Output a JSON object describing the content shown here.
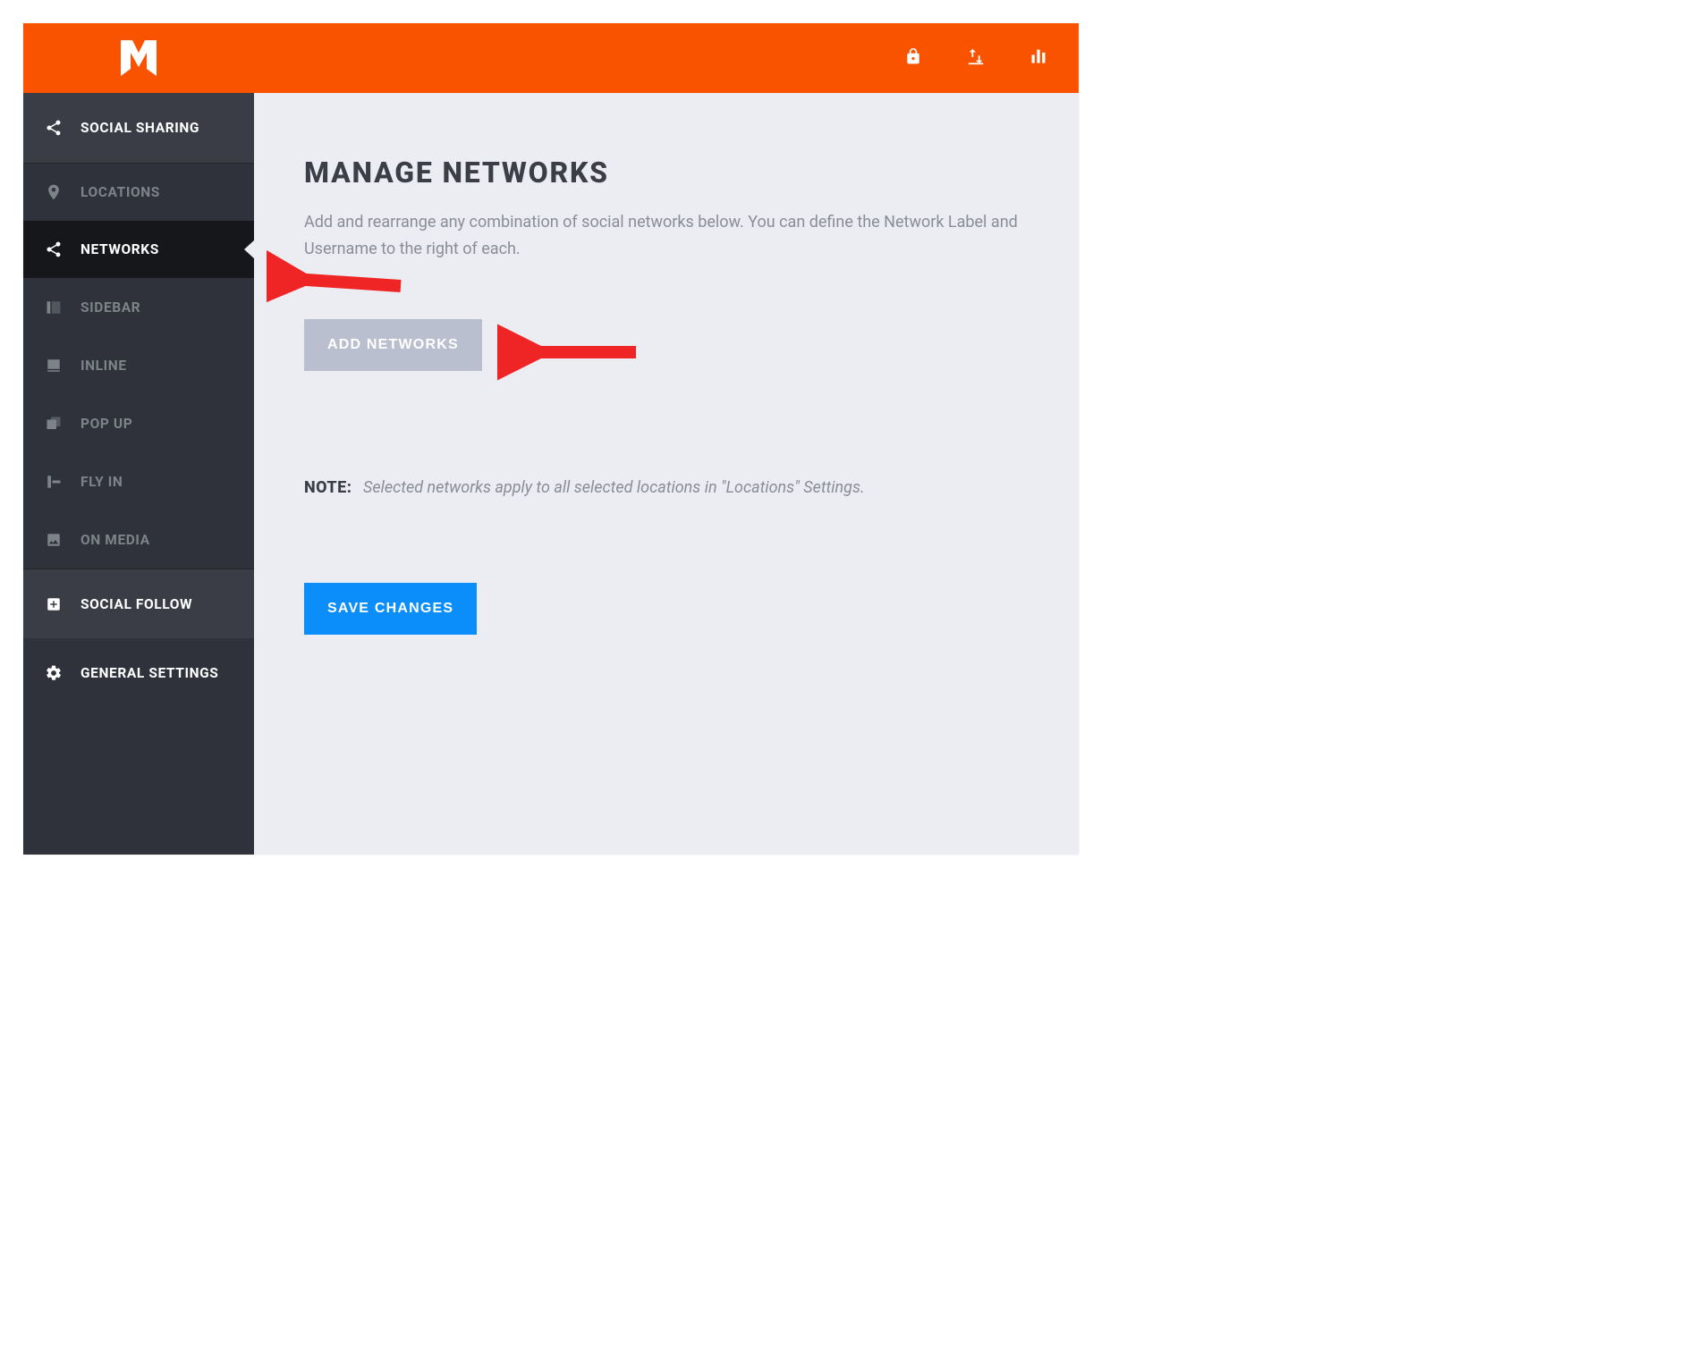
{
  "colors": {
    "accent": "#fa5300",
    "primary_button": "#0c8efa",
    "muted_button": "#b9bfce",
    "sidebar_bg": "#2f323a",
    "sidebar_active_bg": "#16171b",
    "content_bg": "#ebedf2",
    "annotation_arrow": "#ee2524"
  },
  "sidebar": {
    "items": [
      {
        "label": "SOCIAL SHARING",
        "icon": "share-icon",
        "kind": "parent"
      },
      {
        "label": "LOCATIONS",
        "icon": "pin-icon",
        "kind": "child"
      },
      {
        "label": "NETWORKS",
        "icon": "share-icon",
        "kind": "child",
        "active": true
      },
      {
        "label": "SIDEBAR",
        "icon": "sidebar-icon",
        "kind": "child"
      },
      {
        "label": "INLINE",
        "icon": "inline-icon",
        "kind": "child"
      },
      {
        "label": "POP UP",
        "icon": "popup-icon",
        "kind": "child"
      },
      {
        "label": "FLY IN",
        "icon": "flyin-icon",
        "kind": "child"
      },
      {
        "label": "ON MEDIA",
        "icon": "image-icon",
        "kind": "child"
      },
      {
        "label": "SOCIAL FOLLOW",
        "icon": "plus-square-icon",
        "kind": "parent"
      },
      {
        "label": "GENERAL SETTINGS",
        "icon": "gear-icon",
        "kind": "parent"
      }
    ]
  },
  "topbar": {
    "icons": [
      "lock-icon",
      "import-export-icon",
      "bar-chart-icon"
    ]
  },
  "page": {
    "title": "MANAGE NETWORKS",
    "description": "Add and rearrange any combination of social networks below. You can define the Network Label and Username to the right of each.",
    "add_button": "ADD NETWORKS",
    "note_label": "NOTE:",
    "note_text": "Selected networks apply to all selected locations in \"Locations\" Settings.",
    "save_button": "SAVE CHANGES"
  }
}
